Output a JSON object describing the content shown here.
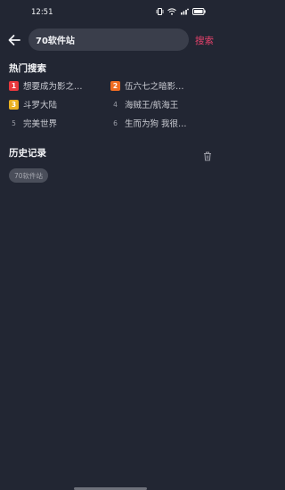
{
  "status_bar": {
    "time": "12:51",
    "battery": "93"
  },
  "search": {
    "value": "70软件站",
    "button_label": "搜索"
  },
  "hot_search": {
    "title": "热门搜索",
    "items": [
      {
        "rank": "1",
        "text": "想要成为影之…",
        "color": "#e8383d"
      },
      {
        "rank": "2",
        "text": "伍六七之暗影…",
        "color": "#ef6c22"
      },
      {
        "rank": "3",
        "text": "斗罗大陆",
        "color": "#e8b021"
      },
      {
        "rank": "4",
        "text": "海贼王/航海王"
      },
      {
        "rank": "5",
        "text": "完美世界"
      },
      {
        "rank": "6",
        "text": "生而为狗 我很…"
      }
    ]
  },
  "history": {
    "title": "历史记录",
    "items": [
      "70软件站"
    ]
  }
}
